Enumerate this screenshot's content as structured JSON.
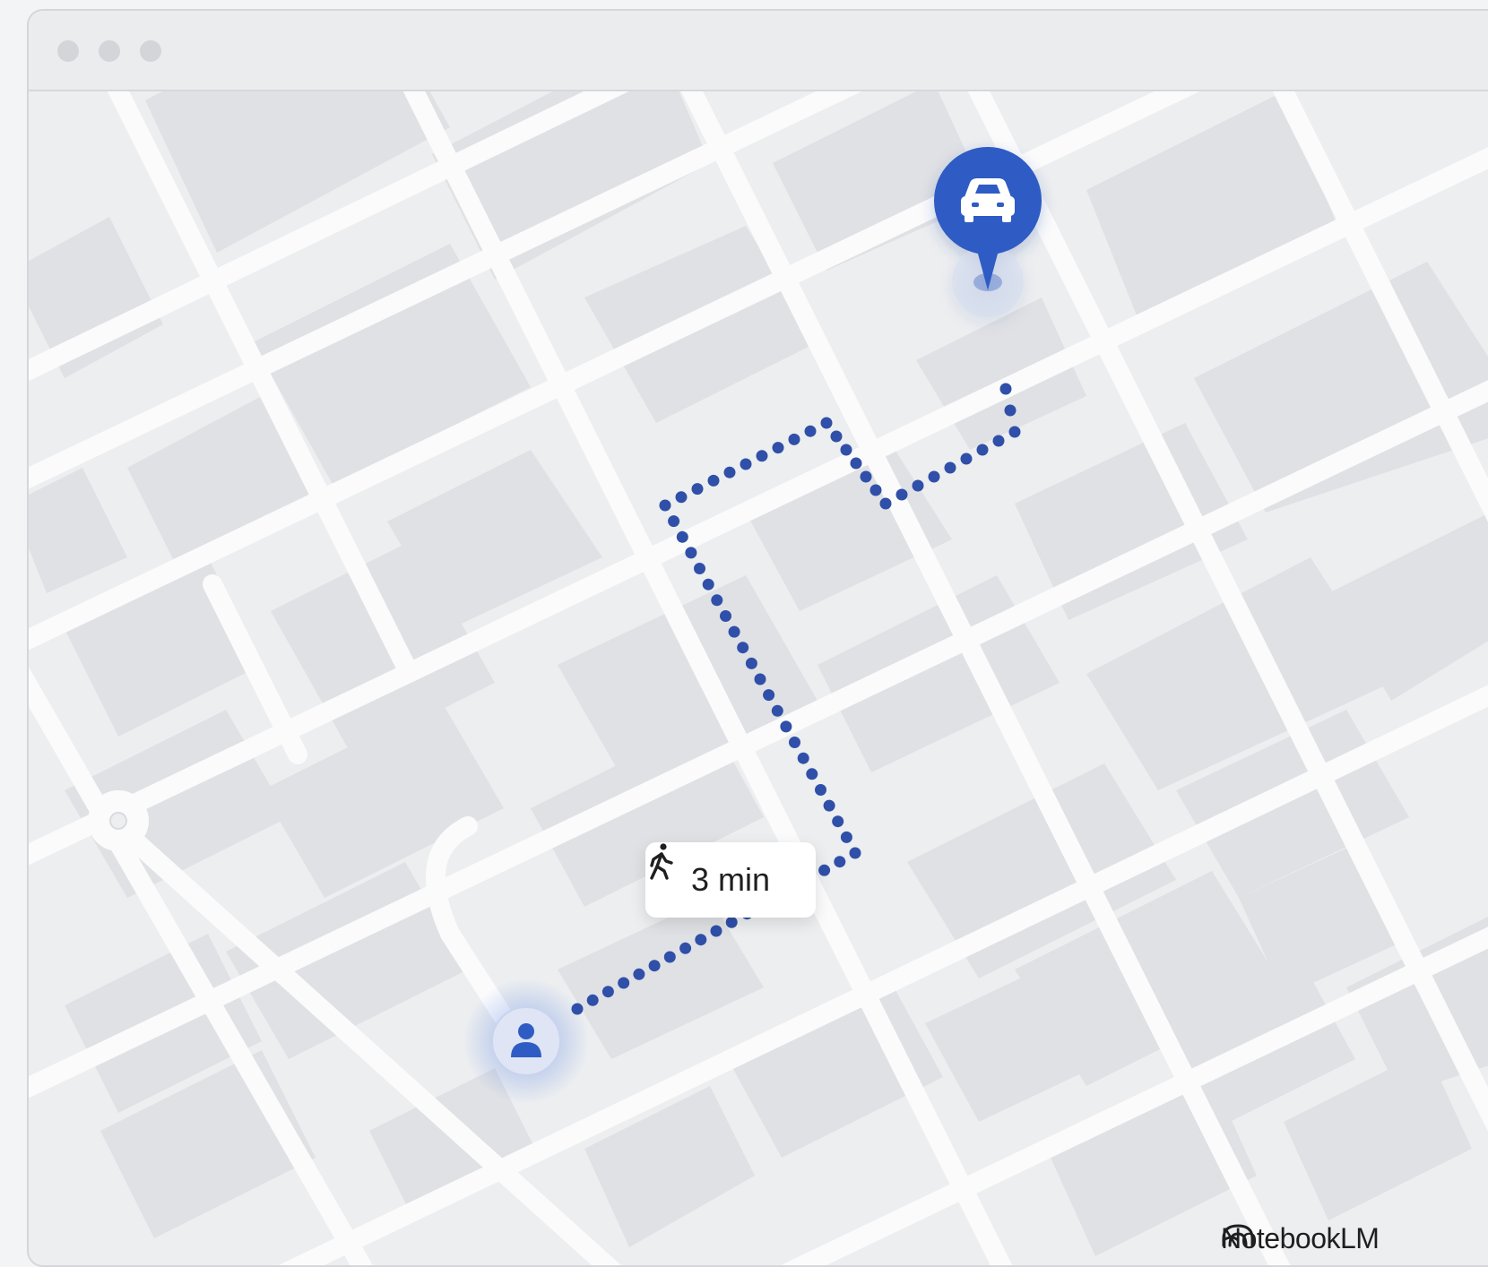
{
  "map": {
    "walk_label": "3 min",
    "brand_name": "NotebookLM",
    "accent_color": "#2f5cc4",
    "route_color": "#2f4fa8",
    "icons": {
      "destination": "car-icon",
      "origin": "person-icon",
      "travel_mode": "walking-icon",
      "brand": "notebooklm-logo-icon"
    }
  },
  "window": {
    "controls": [
      "close",
      "minimize",
      "maximize"
    ]
  }
}
